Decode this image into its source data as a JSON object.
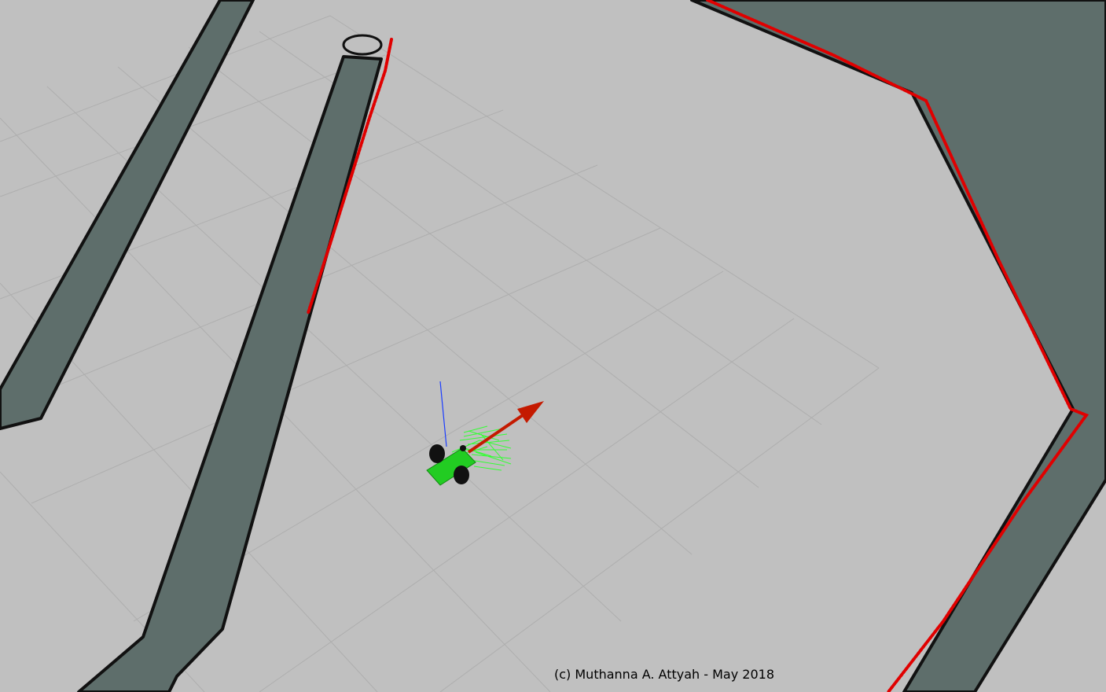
{
  "view": {
    "background_color": "#c0c0c0",
    "grid_color": "#aeaeae",
    "wall_color": "#5e6e6b",
    "wall_edge_color": "#111111",
    "laser_color": "#e00000",
    "robot_color": "#22cc22",
    "particle_color": "#33ff33",
    "heading_arrow_color": "#c41a00",
    "z_axis_color": "#1a3cff"
  },
  "credit": {
    "text": "(c) Muthanna A. Attyah - May 2018"
  }
}
